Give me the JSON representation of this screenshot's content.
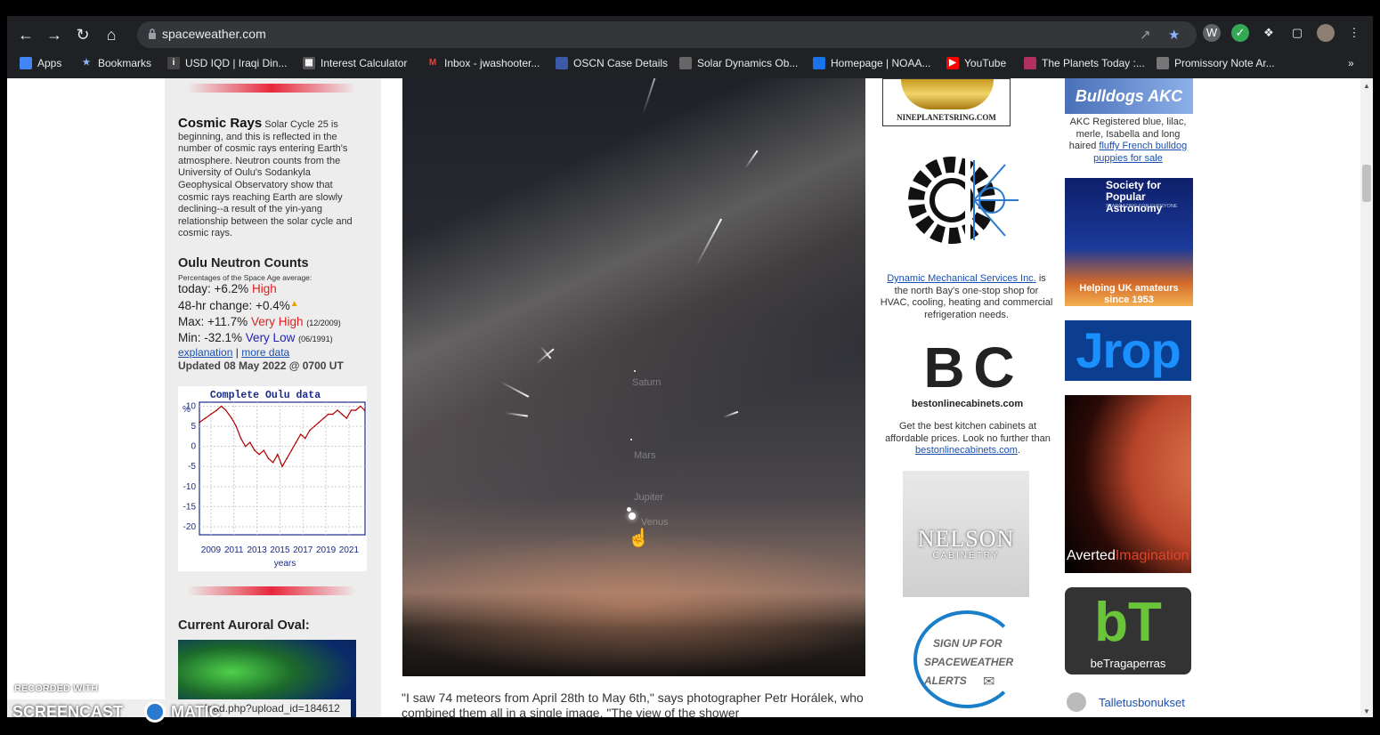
{
  "browser": {
    "url": "spaceweather.com",
    "bookmarks": [
      {
        "label": "Apps",
        "icon": "apps-grid-icon",
        "color": "#4285f4"
      },
      {
        "label": "Bookmarks",
        "icon": "star-icon",
        "color": "#8ab4f8"
      },
      {
        "label": "USD IQD | Iraqi Din...",
        "icon": "inv-icon",
        "color": "#444"
      },
      {
        "label": "Interest Calculator",
        "icon": "calculator-icon",
        "color": "#555"
      },
      {
        "label": "Inbox - jwashooter...",
        "icon": "gmail-icon",
        "color": "#ea4335"
      },
      {
        "label": "OSCN Case Details",
        "icon": "shield-icon",
        "color": "#3b5ba8"
      },
      {
        "label": "Solar Dynamics Ob...",
        "icon": "sdo-icon",
        "color": "#666"
      },
      {
        "label": "Homepage | NOAA...",
        "icon": "noaa-icon",
        "color": "#1a73e8"
      },
      {
        "label": "YouTube",
        "icon": "youtube-icon",
        "color": "#ff0000"
      },
      {
        "label": "The Planets Today :...",
        "icon": "planets-icon",
        "color": "#b03060"
      },
      {
        "label": "Promissory Note Ar...",
        "icon": "doc-icon",
        "color": "#777"
      }
    ],
    "overflow": "»"
  },
  "cosmic": {
    "title": "Cosmic Rays",
    "body": "Solar Cycle 25 is beginning, and this is reflected in the number of cosmic rays entering Earth's atmosphere. Neutron counts from the University of Oulu's Sodankyla Geophysical Observatory show that cosmic rays reaching Earth are slowly declining--a result of the yin-yang relationship between the solar cycle and cosmic rays."
  },
  "neutron": {
    "title": "Oulu Neutron Counts",
    "subtitle": "Percentages of the Space Age average:",
    "today_label": "today: +6.2%",
    "today_level": "High",
    "change_label": "48-hr change: +0.4%",
    "max_label": "Max: +11.7%",
    "max_level": "Very High",
    "max_date": "(12/2009)",
    "min_label": "Min: -32.1%",
    "min_level": "Very Low",
    "min_date": "(06/1991)",
    "link_explanation": "explanation",
    "separator": "|",
    "link_more": "more data",
    "updated": "Updated 08 May 2022 @ 0700 UT"
  },
  "chart_data": {
    "type": "line",
    "title": "Complete Oulu data",
    "ylabel": "%",
    "xlabel": "years",
    "ylim": [
      -22,
      11
    ],
    "yticks": [
      "10",
      "5",
      "0",
      "-5",
      "-10",
      "-15",
      "-20"
    ],
    "xticks": [
      "2009",
      "2011",
      "2013",
      "2015",
      "2017",
      "2019",
      "2021"
    ],
    "xlim": [
      2008,
      2022.4
    ],
    "grid": true,
    "series": [
      {
        "color": "#b00000",
        "x": [
          2008.0,
          2008.5,
          2009.0,
          2009.5,
          2009.9,
          2010.3,
          2010.8,
          2011.2,
          2011.6,
          2012.0,
          2012.4,
          2012.8,
          2013.2,
          2013.6,
          2014.0,
          2014.4,
          2014.8,
          2015.2,
          2015.6,
          2016.0,
          2016.4,
          2016.8,
          2017.2,
          2017.6,
          2018.0,
          2018.4,
          2018.8,
          2019.2,
          2019.6,
          2020.0,
          2020.4,
          2020.8,
          2021.2,
          2021.6,
          2022.0,
          2022.35
        ],
        "y": [
          6,
          7,
          8,
          9,
          10,
          9,
          7,
          5,
          2,
          0,
          1,
          -1,
          -2,
          -1,
          -3,
          -4,
          -2,
          -5,
          -3,
          -1,
          1,
          3,
          2,
          4,
          5,
          6,
          7,
          8,
          8,
          9,
          8,
          7,
          9,
          9,
          10,
          9
        ]
      }
    ]
  },
  "aurora": {
    "title": "Current Auroral Oval:"
  },
  "photo": {
    "labels": [
      "Saturn",
      "Mars",
      "Jupiter",
      "Venus"
    ]
  },
  "quote": {
    "text": "\"I saw 74 meteors from April 28th to May 6th,\" says photographer Petr Horálek, who combined them all in a single image. \"The view of the shower"
  },
  "ads_mid": {
    "nineplanets": "NINEPLANETSRING.COM",
    "dms_link": "Dynamic Mechanical Services Inc.",
    "dms_text": "is the north Bay's one-stop shop for HVAC, cooling, heating and commercial refrigeration needs.",
    "boc_logo": "B C",
    "boc_site": "bestonlinecabinets.com",
    "boc_text": "Get the best kitchen cabinets at affordable prices. Look no further than",
    "boc_link": "bestonlinecabinets.com",
    "boc_period": ".",
    "nelson": "NELSON",
    "nelson_sub": "CABINETRY",
    "signup_1": "SIGN UP FOR",
    "signup_2": "SPACEWEATHER",
    "signup_3": "ALERTS"
  },
  "ads_right": {
    "bulldog_logo": "Bulldogs AKC",
    "bulldog_text": "AKC Registered blue, lilac, merle, Isabella and long haired",
    "bulldog_link": "fluffy French bulldog puppies for sale",
    "spa_title_1": "Society for",
    "spa_title_2": "Popular Astronomy",
    "spa_tag": "STARGAZING FOR EVERYONE",
    "spa_bottom_1": "Helping UK amateurs",
    "spa_bottom_2": "since 1953",
    "jrop": "Jrop",
    "averted_1": "Averted",
    "averted_2": "Imagination",
    "bt_logo": "bT",
    "bt_text": "beTragaperras",
    "talletus": "Talletusbonukset"
  },
  "status_bar": {
    "text": "load.php?upload_id=184612"
  },
  "watermark": {
    "line1": "RECORDED WITH",
    "line2": "SCREENCAST",
    "line3": "MATIC"
  }
}
